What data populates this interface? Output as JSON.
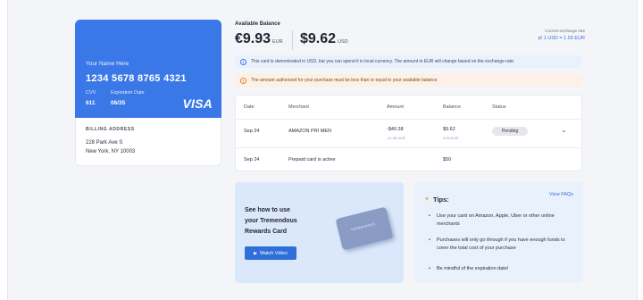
{
  "card": {
    "holder": "Your Name Here",
    "number": "1234 5678 8765 4321",
    "cvv_label": "CVV",
    "cvv_value": "611",
    "exp_label": "Expiration Date",
    "exp_value": "06/35",
    "brand": "VISA",
    "brand_color": "#3b78e7"
  },
  "billing": {
    "heading": "BILLING ADDRESS",
    "line1": "228 Park Ave S",
    "line2": "New York, NY 10003"
  },
  "balance": {
    "label": "Available Balance",
    "eur_amount": "€9.93",
    "eur_unit": "EUR",
    "usd_amount": "$9.62",
    "usd_unit": "USD",
    "rate_label": "Current exchange rate",
    "rate_value": "1 USD = 1.03 EUR"
  },
  "notices": {
    "info": "This card is denominated in USD, but you can spend it in local currency. The amount in EUR will change based on the exchange rate.",
    "warning": "The amount authorized for your purchase must be less than or equal to your available balance"
  },
  "table": {
    "headers": [
      "Date",
      "Merchant",
      "Amount",
      "Balance",
      "Status"
    ],
    "rows": [
      {
        "date": "Sep 24",
        "merchant": "AMAZON PRI MEN",
        "amount": "-$40.38",
        "amount_sub": "-41.58 EUR",
        "balance": "$9.62",
        "balance_sub": "9.93 EUR",
        "status": "Pending"
      },
      {
        "date": "Sep 24",
        "merchant": "Prepaid card is active",
        "amount": "",
        "amount_sub": "",
        "balance": "$50",
        "balance_sub": "",
        "status": ""
      }
    ]
  },
  "howto": {
    "line1": "See how to use",
    "line2": "your Tremendous",
    "line3": "Rewards Card",
    "button": "Watch Video",
    "card_text": "TREMENDOUS"
  },
  "tips": {
    "title": "Tips:",
    "faq_link": "View FAQs",
    "items": [
      "Use your card on Amazon, Apple, Uber or other online merchants",
      "Purchases will only go through if you have enough funds to cover the total cost of your purchase",
      "Be mindful of the expiration date!"
    ]
  }
}
